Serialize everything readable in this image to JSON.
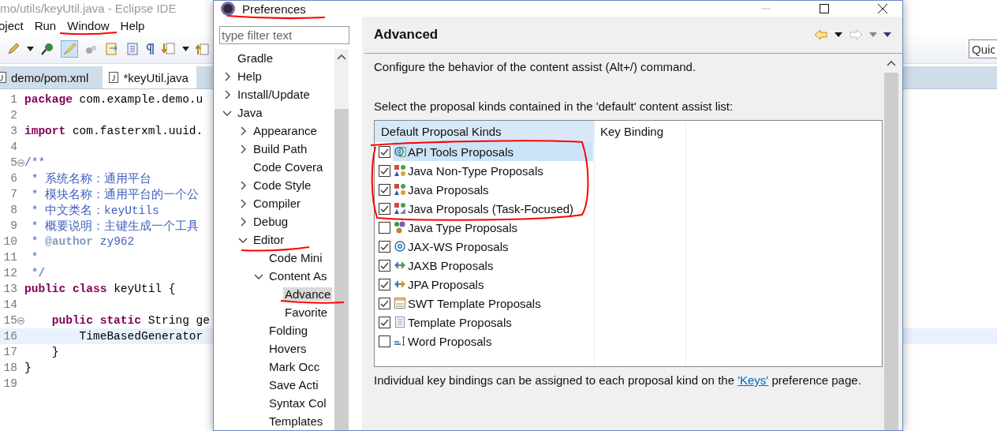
{
  "ide": {
    "title": "mo/utils/keyUtil.java - Eclipse IDE",
    "menu": [
      "oject",
      "Run",
      "Window",
      "Help"
    ],
    "quick_access": {
      "placeholder": "Quic"
    },
    "tabs": [
      {
        "label": "demo/pom.xml",
        "selected": false
      },
      {
        "label": "*keyUtil.java",
        "selected": true
      }
    ],
    "code": [
      {
        "number": "1",
        "current": false,
        "tokens": [
          {
            "t": "package",
            "kind": "keyword"
          },
          {
            "t": " com.example.demo.u",
            "kind": "plain"
          }
        ]
      },
      {
        "number": "2",
        "current": false
      },
      {
        "number": "3",
        "current": false,
        "tokens": [
          {
            "t": "import",
            "kind": "keyword"
          },
          {
            "t": " com.fasterxml.uuid.",
            "kind": "plain"
          }
        ]
      },
      {
        "number": "4",
        "current": false
      },
      {
        "number": "5",
        "current": false,
        "fold": true,
        "tokens": [
          {
            "t": "/**",
            "kind": "comment"
          }
        ]
      },
      {
        "number": "6",
        "current": false,
        "tokens": [
          {
            "t": " * 系统名称：通用平台",
            "kind": "comment"
          }
        ]
      },
      {
        "number": "7",
        "current": false,
        "tokens": [
          {
            "t": " * 模块名称：通用平台的一个公",
            "kind": "comment"
          }
        ]
      },
      {
        "number": "8",
        "current": false,
        "tokens": [
          {
            "t": " * 中文类名：keyUtils",
            "kind": "comment"
          }
        ]
      },
      {
        "number": "9",
        "current": false,
        "tokens": [
          {
            "t": " * 概要说明：主键生成一个工具",
            "kind": "comment"
          }
        ]
      },
      {
        "number": "10",
        "current": false,
        "tokens": [
          {
            "t": " * ",
            "kind": "comment"
          },
          {
            "t": "@author",
            "kind": "tag"
          },
          {
            "t": " zy962",
            "kind": "comment"
          }
        ]
      },
      {
        "number": "11",
        "current": false,
        "tokens": [
          {
            "t": " *",
            "kind": "comment"
          }
        ]
      },
      {
        "number": "12",
        "current": false,
        "tokens": [
          {
            "t": " */",
            "kind": "comment"
          }
        ]
      },
      {
        "number": "13",
        "current": false,
        "tokens": [
          {
            "t": "public",
            "kind": "keyword"
          },
          {
            "t": " class",
            "kind": "keyword"
          },
          {
            "t": " keyUtil {",
            "kind": "plain"
          }
        ]
      },
      {
        "number": "14",
        "current": false
      },
      {
        "number": "15",
        "current": false,
        "fold": true,
        "tokens": [
          {
            "t": "    public",
            "kind": "keyword"
          },
          {
            "t": " static",
            "kind": "keyword"
          },
          {
            "t": " String ge",
            "kind": "plain"
          }
        ]
      },
      {
        "number": "16",
        "current": true,
        "tokens": [
          {
            "t": "        TimeBasedGenerator",
            "kind": "plain"
          }
        ]
      },
      {
        "number": "17",
        "current": false,
        "tokens": [
          {
            "t": "    }",
            "kind": "plain"
          }
        ]
      },
      {
        "number": "18",
        "current": false,
        "tokens": [
          {
            "t": "}",
            "kind": "plain"
          }
        ]
      },
      {
        "number": "19",
        "current": false
      }
    ]
  },
  "dialog": {
    "title": "Preferences",
    "filter": {
      "placeholder": "type filter text"
    },
    "tree": [
      {
        "label": "Gradle",
        "selected": false
      },
      {
        "label": "Help",
        "expanded": false,
        "selected": false
      },
      {
        "label": "Install/Update",
        "expanded": false,
        "selected": false
      },
      {
        "label": "Java",
        "expanded": true,
        "selected": false,
        "children": [
          {
            "label": "Appearance",
            "expanded": false,
            "selected": false
          },
          {
            "label": "Build Path",
            "expanded": false,
            "selected": false
          },
          {
            "label": "Code Covera",
            "selected": false
          },
          {
            "label": "Code Style",
            "expanded": false,
            "selected": false
          },
          {
            "label": "Compiler",
            "expanded": false,
            "selected": false
          },
          {
            "label": "Debug",
            "expanded": false,
            "selected": false
          },
          {
            "label": "Editor",
            "expanded": true,
            "selected": false,
            "children": [
              {
                "label": "Code Mini",
                "selected": false
              },
              {
                "label": "Content As",
                "expanded": true,
                "selected": false,
                "children": [
                  {
                    "label": "Advance",
                    "selected": true
                  },
                  {
                    "label": "Favorite",
                    "selected": false
                  }
                ]
              },
              {
                "label": "Folding",
                "selected": false
              },
              {
                "label": "Hovers",
                "selected": false
              },
              {
                "label": "Mark Occ",
                "selected": false
              },
              {
                "label": "Save Acti",
                "selected": false
              },
              {
                "label": "Syntax Col",
                "selected": false
              },
              {
                "label": "Templates",
                "selected": false
              }
            ]
          }
        ]
      }
    ],
    "page": {
      "title": "Advanced",
      "description": "Configure the behavior of the content assist (Alt+/) command.",
      "list_label": "Select the proposal kinds contained in the 'default' content assist list:",
      "columns": [
        "Default Proposal Kinds",
        "Key Binding"
      ],
      "rows": [
        {
          "label": "API Tools Proposals",
          "kind": "api",
          "checked": true,
          "selected": true
        },
        {
          "label": "Java Non-Type Proposals",
          "kind": "java",
          "checked": true,
          "selected": false
        },
        {
          "label": "Java Proposals",
          "kind": "java",
          "checked": true,
          "selected": false
        },
        {
          "label": "Java Proposals (Task-Focused)",
          "kind": "javatask",
          "checked": true,
          "selected": false
        },
        {
          "label": "Java Type Proposals",
          "kind": "javatype",
          "checked": false,
          "selected": false
        },
        {
          "label": "JAX-WS Proposals",
          "kind": "jaxws",
          "checked": true,
          "selected": false
        },
        {
          "label": "JAXB Proposals",
          "kind": "jaxb",
          "checked": true,
          "selected": false
        },
        {
          "label": "JPA Proposals",
          "kind": "jpa",
          "checked": true,
          "selected": false
        },
        {
          "label": "SWT Template Proposals",
          "kind": "swt",
          "checked": true,
          "selected": false
        },
        {
          "label": "Template Proposals",
          "kind": "template",
          "checked": true,
          "selected": false
        },
        {
          "label": "Word Proposals",
          "kind": "word",
          "checked": false,
          "selected": false
        }
      ],
      "footer": {
        "before": "Individual key bindings can be assigned to each proposal kind on the ",
        "link": "'Keys'",
        "after": " preference page."
      }
    }
  }
}
